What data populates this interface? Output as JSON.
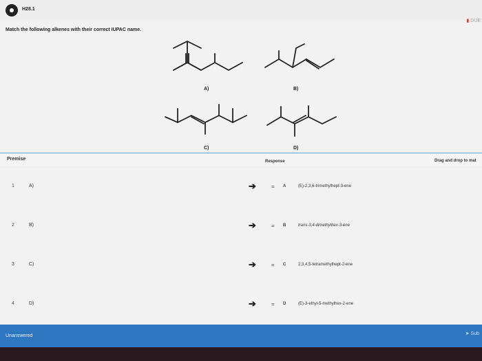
{
  "app": {
    "title": "H28.1",
    "due_label": "DUE:"
  },
  "instruction": "Match the following alkenes with their correct IUPAC name.",
  "structures": [
    {
      "label": "A)"
    },
    {
      "label": "B)"
    },
    {
      "label": "C)"
    },
    {
      "label": "D)"
    }
  ],
  "headers": {
    "premise": "Premise",
    "response": "Response",
    "drag": "Drag and drop to mat"
  },
  "rows": [
    {
      "num": "1",
      "premise": "A)",
      "arrow": "➔",
      "handle": "=",
      "letter": "A",
      "response": "(E)-2,3,6-trimethylhept-3-ene"
    },
    {
      "num": "2",
      "premise": "B)",
      "arrow": "➔",
      "handle": "=",
      "letter": "B",
      "response": "trans-3,4-dimethylhex-3-ene"
    },
    {
      "num": "3",
      "premise": "C)",
      "arrow": "➔",
      "handle": "=",
      "letter": "C",
      "response": "2,3,4,5-tetramethylhept-2-ene"
    },
    {
      "num": "4",
      "premise": "D)",
      "arrow": "➔",
      "handle": "=",
      "letter": "D",
      "response": "(E)-3-ethyl-5-methylhex-2-ene"
    }
  ],
  "footer": {
    "status": "Unanswered",
    "submit": "Sub"
  },
  "colors": {
    "footer": "#2e77c0",
    "divider": "#6aa4d8"
  }
}
